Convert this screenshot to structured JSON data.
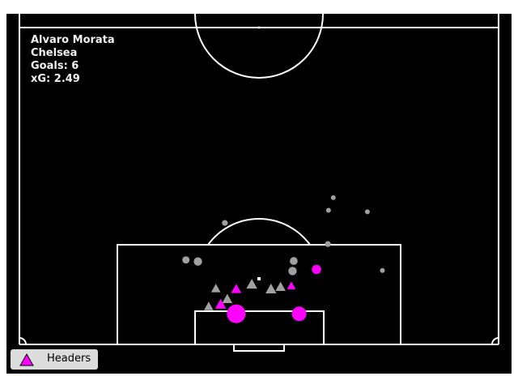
{
  "chart_data": {
    "type": "scatter",
    "title": "",
    "annotation_lines": [
      "Alvaro Morata",
      "Chelsea",
      "Goals: 6",
      "xG: 2.49"
    ],
    "legend": [
      {
        "label": "Headers",
        "marker": "triangle",
        "color": "#ff00ff"
      }
    ],
    "legend_position": "bottom-left",
    "pitch_units": {
      "x_range": [
        0,
        80
      ],
      "y_range": [
        60,
        120
      ],
      "goal_line_y": 120
    },
    "colors": {
      "background": "#000000",
      "lines": "#ffffff",
      "goal": "#ff00ff",
      "no_goal": "#a0a0a0"
    },
    "series": [
      {
        "name": "Headers",
        "marker": "triangle",
        "points": [
          {
            "x": 33.6,
            "y": 112.4,
            "xg": 0.06,
            "goal": true
          },
          {
            "x": 36.2,
            "y": 109.5,
            "xg": 0.05,
            "goal": true
          },
          {
            "x": 45.4,
            "y": 108.9,
            "xg": 0.03,
            "goal": true
          },
          {
            "x": 34.7,
            "y": 111.4,
            "xg": 0.05,
            "goal": false
          },
          {
            "x": 31.6,
            "y": 112.8,
            "xg": 0.04,
            "goal": false
          },
          {
            "x": 38.8,
            "y": 108.6,
            "xg": 0.06,
            "goal": false
          },
          {
            "x": 42.0,
            "y": 109.5,
            "xg": 0.06,
            "goal": false
          },
          {
            "x": 43.6,
            "y": 109.1,
            "xg": 0.05,
            "goal": false
          },
          {
            "x": 32.8,
            "y": 109.4,
            "xg": 0.04,
            "goal": false
          }
        ]
      },
      {
        "name": "Shots",
        "marker": "circle",
        "points": [
          {
            "x": 36.2,
            "y": 114.2,
            "xg": 0.45,
            "goal": true
          },
          {
            "x": 46.7,
            "y": 114.2,
            "xg": 0.25,
            "goal": true
          },
          {
            "x": 49.6,
            "y": 105.8,
            "xg": 0.08,
            "goal": true
          },
          {
            "x": 29.8,
            "y": 104.3,
            "xg": 0.06,
            "goal": false
          },
          {
            "x": 27.8,
            "y": 104.0,
            "xg": 0.04,
            "goal": false
          },
          {
            "x": 45.8,
            "y": 104.2,
            "xg": 0.05,
            "goal": false
          },
          {
            "x": 45.6,
            "y": 106.1,
            "xg": 0.06,
            "goal": false
          },
          {
            "x": 51.5,
            "y": 101.0,
            "xg": 0.02,
            "goal": false
          },
          {
            "x": 34.3,
            "y": 97.0,
            "xg": 0.02,
            "goal": false
          },
          {
            "x": 51.6,
            "y": 94.6,
            "xg": 0.01,
            "goal": false
          },
          {
            "x": 52.4,
            "y": 92.2,
            "xg": 0.01,
            "goal": false
          },
          {
            "x": 58.1,
            "y": 94.9,
            "xg": 0.01,
            "goal": false
          },
          {
            "x": 60.6,
            "y": 106.0,
            "xg": 0.01,
            "goal": false
          }
        ]
      }
    ]
  }
}
